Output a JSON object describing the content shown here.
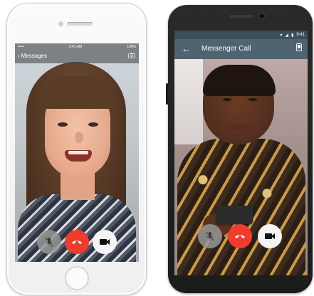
{
  "ios": {
    "status": {
      "carrier": "•••••",
      "time": "9:41 AM",
      "battery": "100%"
    },
    "nav": {
      "back_label": "Messages"
    },
    "controls": {
      "mute": "mic-off-icon",
      "end": "end-call-icon",
      "video": "video-icon"
    }
  },
  "android": {
    "status": {
      "time": "9:41"
    },
    "appbar": {
      "title": "Messenger Call"
    },
    "controls": {
      "mute": "mic-off-icon",
      "end": "end-call-icon",
      "video": "video-icon"
    }
  },
  "colors": {
    "end_call": "#f03c2e",
    "android_appbar": "#4f6470",
    "android_status": "#3b4e5a"
  }
}
